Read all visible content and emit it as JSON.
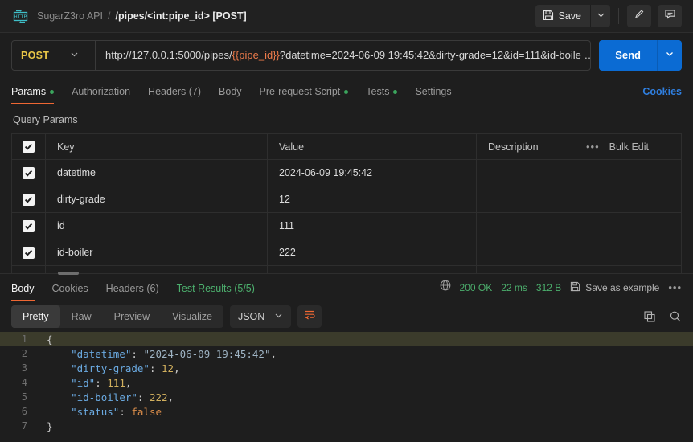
{
  "header": {
    "icon": "http-protocol-icon",
    "collection": "SugarZ3ro API",
    "separator": "/",
    "request_name": "/pipes/<int:pipe_id> [POST]",
    "save_label": "Save",
    "save_icon": "floppy-disk-icon",
    "save_caret_icon": "chevron-down-icon",
    "edit_icon": "pencil-icon",
    "comment_icon": "comment-icon"
  },
  "urlbar": {
    "method": "POST",
    "method_caret_icon": "chevron-down-icon",
    "url_prefix": "http://127.0.0.1:5000/pipes/",
    "url_variable": "{{pipe_id}}",
    "url_suffix": "?datetime=2024-06-09 19:45:42&dirty-grade=12&id=111&id-boile …",
    "send_label": "Send",
    "send_caret_icon": "chevron-down-icon",
    "send_color": "#0b6bd3",
    "method_color": "#e8c547",
    "variable_color": "#f07c4b"
  },
  "request_tabs": {
    "items": [
      {
        "label": "Params",
        "active": true,
        "dot": true,
        "count": null
      },
      {
        "label": "Authorization",
        "active": false,
        "dot": false,
        "count": null
      },
      {
        "label": "Headers (7)",
        "active": false,
        "dot": false,
        "count": 7
      },
      {
        "label": "Body",
        "active": false,
        "dot": false,
        "count": null
      },
      {
        "label": "Pre-request Script",
        "active": false,
        "dot": true,
        "count": null
      },
      {
        "label": "Tests",
        "active": false,
        "dot": true,
        "count": null
      },
      {
        "label": "Settings",
        "active": false,
        "dot": false,
        "count": null
      }
    ],
    "cookies_link": "Cookies",
    "active_underline_color": "#ef6733",
    "dot_color": "#3ba55d",
    "cookies_color": "#2f7fe0"
  },
  "query_params": {
    "section_title": "Query Params",
    "columns": {
      "key": "Key",
      "value": "Value",
      "description": "Description"
    },
    "bulk_edit_label": "Bulk Edit",
    "more_icon": "ellipsis-icon",
    "header_checked": true,
    "rows": [
      {
        "checked": true,
        "key": "datetime",
        "value": "2024-06-09 19:45:42",
        "description": ""
      },
      {
        "checked": true,
        "key": "dirty-grade",
        "value": "12",
        "description": ""
      },
      {
        "checked": true,
        "key": "id",
        "value": "111",
        "description": ""
      },
      {
        "checked": true,
        "key": "id-boiler",
        "value": "222",
        "description": ""
      },
      {
        "checked": true,
        "key": "",
        "value": "",
        "description": ""
      }
    ]
  },
  "response": {
    "tabs": [
      {
        "label": "Body",
        "active": true
      },
      {
        "label": "Cookies",
        "active": false
      },
      {
        "label": "Headers (6)",
        "active": false
      },
      {
        "label": "Test Results (5/5)",
        "active": false,
        "green_suffix": "(5/5)"
      }
    ],
    "globe_icon": "globe-icon",
    "status": "200 OK",
    "time": "22 ms",
    "size": "312 B",
    "save_example_label": "Save as example",
    "save_example_icon": "floppy-disk-icon",
    "more_icon": "ellipsis-icon",
    "status_color": "#4caf6d",
    "view_modes": [
      {
        "label": "Pretty",
        "active": true
      },
      {
        "label": "Raw",
        "active": false
      },
      {
        "label": "Preview",
        "active": false
      },
      {
        "label": "Visualize",
        "active": false
      }
    ],
    "format": "JSON",
    "format_caret_icon": "chevron-down-icon",
    "wrap_icon": "word-wrap-icon",
    "copy_icon": "copy-icon",
    "search_icon": "search-icon"
  },
  "code": {
    "lines": [
      {
        "n": "1",
        "highlight": true,
        "tokens": [
          {
            "t": "{",
            "c": "p"
          }
        ]
      },
      {
        "n": "2",
        "highlight": false,
        "tokens": [
          {
            "t": "    ",
            "c": "p"
          },
          {
            "t": "\"datetime\"",
            "c": "k"
          },
          {
            "t": ": ",
            "c": "p"
          },
          {
            "t": "\"2024-06-09 19:45:42\"",
            "c": "s"
          },
          {
            "t": ",",
            "c": "p"
          }
        ]
      },
      {
        "n": "3",
        "highlight": false,
        "tokens": [
          {
            "t": "    ",
            "c": "p"
          },
          {
            "t": "\"dirty-grade\"",
            "c": "k"
          },
          {
            "t": ": ",
            "c": "p"
          },
          {
            "t": "12",
            "c": "n"
          },
          {
            "t": ",",
            "c": "p"
          }
        ]
      },
      {
        "n": "4",
        "highlight": false,
        "tokens": [
          {
            "t": "    ",
            "c": "p"
          },
          {
            "t": "\"id\"",
            "c": "k"
          },
          {
            "t": ": ",
            "c": "p"
          },
          {
            "t": "111",
            "c": "n"
          },
          {
            "t": ",",
            "c": "p"
          }
        ]
      },
      {
        "n": "5",
        "highlight": false,
        "tokens": [
          {
            "t": "    ",
            "c": "p"
          },
          {
            "t": "\"id-boiler\"",
            "c": "k"
          },
          {
            "t": ": ",
            "c": "p"
          },
          {
            "t": "222",
            "c": "n"
          },
          {
            "t": ",",
            "c": "p"
          }
        ]
      },
      {
        "n": "6",
        "highlight": false,
        "tokens": [
          {
            "t": "    ",
            "c": "p"
          },
          {
            "t": "\"status\"",
            "c": "k"
          },
          {
            "t": ": ",
            "c": "p"
          },
          {
            "t": "false",
            "c": "b"
          }
        ]
      },
      {
        "n": "7",
        "highlight": false,
        "tokens": [
          {
            "t": "}",
            "c": "p"
          }
        ]
      }
    ]
  }
}
